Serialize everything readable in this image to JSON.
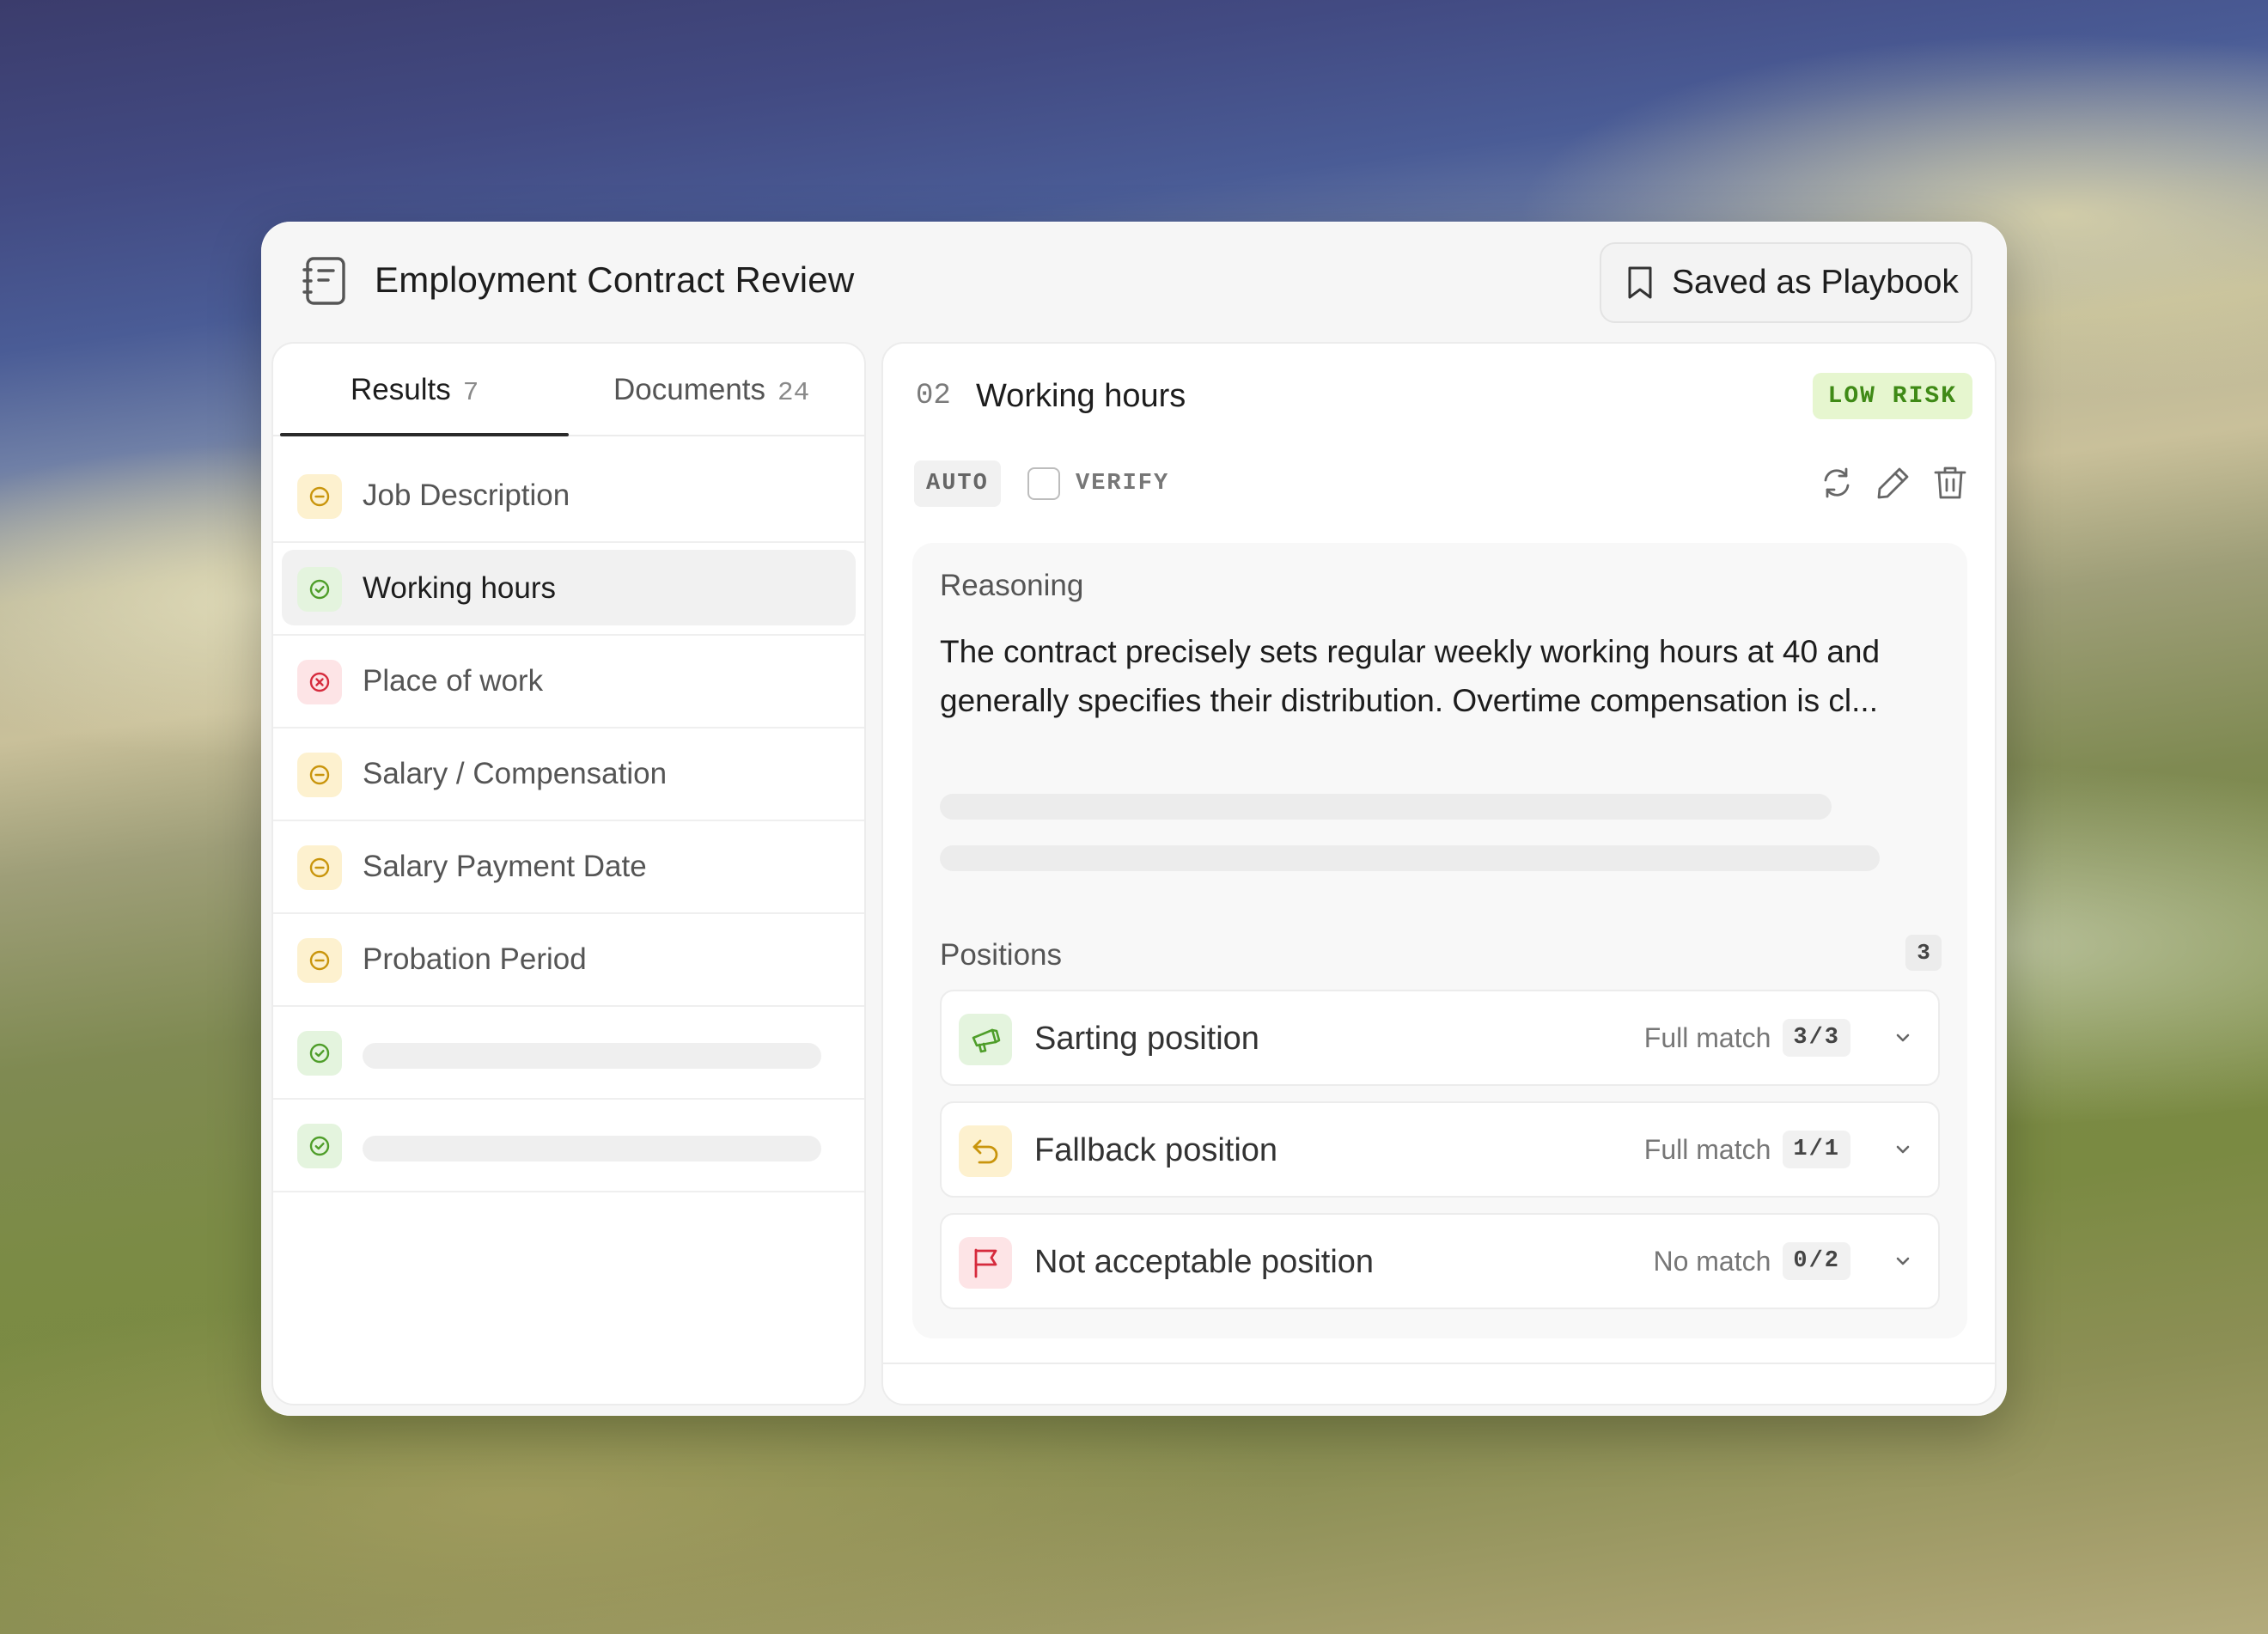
{
  "window": {
    "title": "Employment Contract Review",
    "playbook_button": "Saved as Playbook"
  },
  "tabs": [
    {
      "label": "Results",
      "count": "7",
      "active": true
    },
    {
      "label": "Documents",
      "count": "24",
      "active": false
    }
  ],
  "results": [
    {
      "label": "Job Description",
      "status": "partial",
      "icon": "minus-circle-icon"
    },
    {
      "label": "Working hours",
      "status": "ok",
      "icon": "check-circle-icon",
      "active": true
    },
    {
      "label": "Place of work",
      "status": "fail",
      "icon": "x-circle-icon"
    },
    {
      "label": "Salary / Compensation",
      "status": "partial",
      "icon": "minus-circle-icon"
    },
    {
      "label": "Salary Payment Date",
      "status": "partial",
      "icon": "minus-circle-icon"
    },
    {
      "label": "Probation Period",
      "status": "partial",
      "icon": "minus-circle-icon"
    },
    {
      "label": "",
      "status": "ok",
      "icon": "check-circle-icon",
      "placeholder": true
    },
    {
      "label": "",
      "status": "ok",
      "icon": "check-circle-icon",
      "placeholder": true
    }
  ],
  "detail": {
    "number": "02",
    "title": "Working hours",
    "risk": "LOW RISK",
    "auto_tag": "AUTO",
    "verify_label": "VERIFY",
    "reasoning_heading": "Reasoning",
    "reasoning_text": "The contract precisely sets regular weekly working hours at 40 and generally specifies their distribution. Overtime compensation is cl...",
    "positions_heading": "Positions",
    "positions_count": "3",
    "positions": [
      {
        "title": "Sarting position",
        "match": "Full match",
        "ratio": "3/3",
        "icon": "megaphone-icon"
      },
      {
        "title": "Fallback position",
        "match": "Full match",
        "ratio": "1/1",
        "icon": "undo-arrow-icon"
      },
      {
        "title": "Not acceptable position",
        "match": "No match",
        "ratio": "0/2",
        "icon": "flag-icon"
      }
    ]
  },
  "colors": {
    "ok": "#4f9e2a",
    "partial": "#c9950c",
    "fail": "#d62b3d",
    "risk_low_text": "#3f8a16",
    "risk_low_bg": "#e6f6cf"
  }
}
